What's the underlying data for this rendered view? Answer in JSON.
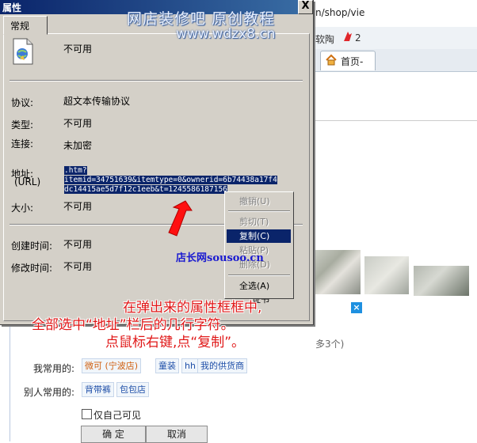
{
  "dialog": {
    "title": "属性",
    "close_glyph": "X",
    "tab": "常规",
    "file_name": "不可用",
    "fields": [
      {
        "label": "协议:",
        "value": "超文本传输协议"
      },
      {
        "label": "类型:",
        "value": "不可用"
      },
      {
        "label": "连接:",
        "value": "未加密"
      },
      {
        "label": "大小:",
        "value": "不可用"
      },
      {
        "label": "创建时间:",
        "value": "不可用"
      },
      {
        "label": "修改时间:",
        "value": "不可用"
      }
    ],
    "address_label": "地址:",
    "address_sublabel": "(URL)",
    "address_lines": [
      ".htm?",
      "itemid=34751639&itemtype=0&ownerid=6b74438a17f4",
      "dc14415ae5d7f12c1eeb&t=1245586187156"
    ],
    "cert_button": "证书"
  },
  "context_menu": {
    "items": [
      {
        "label": "撤销(U)",
        "state": "disabled"
      },
      {
        "label": "剪切(T)",
        "state": "disabled"
      },
      {
        "label": "复制(C)",
        "state": "selected"
      },
      {
        "label": "粘贴(P)",
        "state": "disabled"
      },
      {
        "label": "删除(D)",
        "state": "disabled"
      },
      {
        "label": "全选(A)",
        "state": "enabled"
      }
    ]
  },
  "browser": {
    "url_fragment": "n/shop/vie",
    "fav_text": "软陶",
    "fav_num": "2",
    "tab_label": "首页-",
    "tab_icon": "home-icon",
    "close_glyph": "×",
    "count_text": "多3个)"
  },
  "tags_panel": {
    "my_common_label": "我常用的:",
    "my_common_tags": [
      "微可 (宁波店)",
      "童装",
      "hh",
      "我的供货商"
    ],
    "others_common_label": "别人常用的:",
    "others_common_tags": [
      "背带裤",
      "包包店"
    ],
    "self_only_label": "仅自己可见",
    "confirm_label": "确 定",
    "cancel_label": "取消"
  },
  "watermark": {
    "line1": "网店装修吧 原创教程",
    "line2": "www.wdzx8.cn",
    "site": "店长网sousoo.cn"
  },
  "annotation": {
    "lines": [
      "在弹出来的属性框框中,",
      "全部选中“地址”栏后的几行字符。",
      "点鼠标右键,点“复制”。"
    ]
  },
  "colors": {
    "title_bar": "#0a246a",
    "selection": "#0a246a",
    "annotation": "#e01818",
    "arrow": "#ff0000",
    "site_watermark": "#1a1ad0"
  }
}
